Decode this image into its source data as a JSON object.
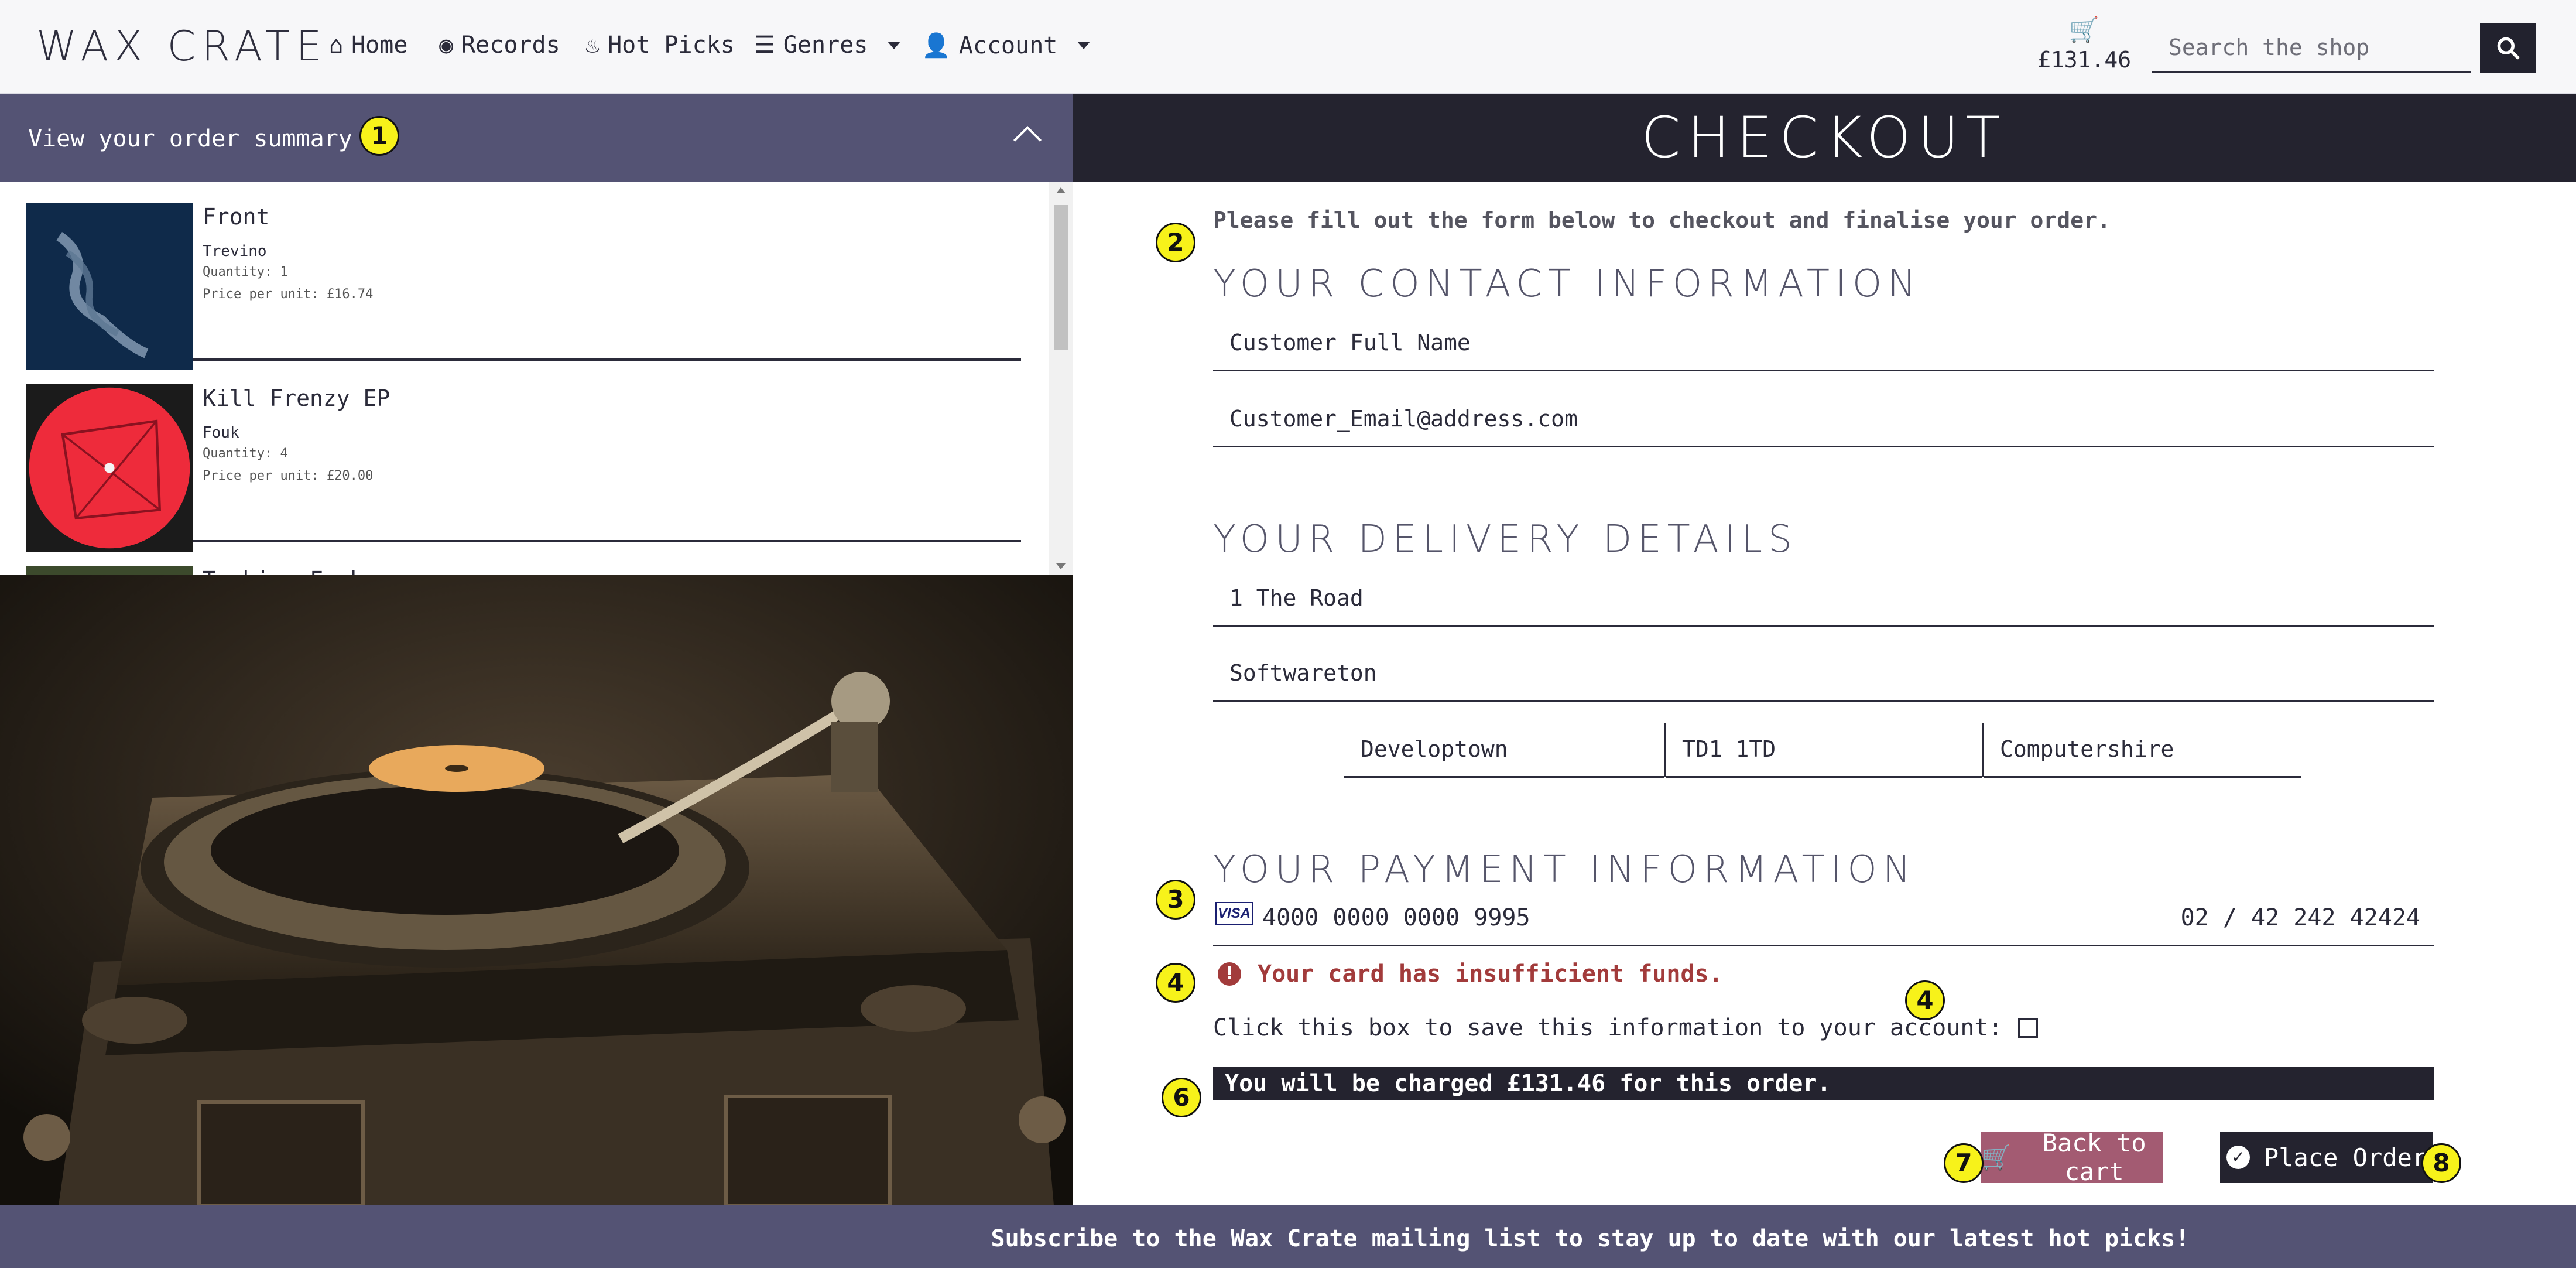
{
  "navbar": {
    "brand": "WAX CRATE",
    "items": [
      {
        "label": "Home",
        "icon": "home-icon"
      },
      {
        "label": "Records",
        "icon": "record-icon"
      },
      {
        "label": "Hot Picks",
        "icon": "flame-icon"
      },
      {
        "label": "Genres",
        "icon": "list-icon"
      },
      {
        "label": "Account",
        "icon": "user-gear-icon"
      }
    ],
    "cart_total": "£131.46",
    "search_placeholder": "Search the shop"
  },
  "order_summary": {
    "header": "View your order summary",
    "items": [
      {
        "title": "Front",
        "artist": "Trevino",
        "quantity": "Quantity: 1",
        "price": "Price per unit: £16.74"
      },
      {
        "title": "Kill Frenzy EP",
        "artist": "Fouk",
        "quantity": "Quantity: 4",
        "price": "Price per unit: £20.00"
      },
      {
        "title": "Techies Funk",
        "artist": "",
        "quantity": "",
        "price": ""
      }
    ]
  },
  "checkout": {
    "title": "CHECKOUT",
    "intro": "Please fill out the form below to checkout and finalise your order.",
    "contact": {
      "heading": "YOUR CONTACT INFORMATION",
      "full_name": "Customer Full Name",
      "email": "Customer_Email@address.com"
    },
    "delivery": {
      "heading": "YOUR DELIVERY DETAILS",
      "line1": "1 The Road",
      "line2": "Softwareton",
      "town": "Developtown",
      "postcode": "TD1 1TD",
      "county": "Computershire"
    },
    "payment": {
      "heading": "YOUR PAYMENT INFORMATION",
      "card_brand": "VISA",
      "card_number": "4000 0000 0000 9995",
      "expiry_cvc_zip": "02 / 42 242  42424"
    },
    "error": "Your card has insufficient funds.",
    "save_info_label": "Click this box to save this information to your account:",
    "save_info_checked": false,
    "charge_text": "You will be charged £131.46 for this order.",
    "back_button": "Back to cart",
    "place_button": "Place Order"
  },
  "markers": [
    "1",
    "2",
    "3",
    "4",
    "4",
    "6",
    "7",
    "8"
  ],
  "footer": {
    "text": "Subscribe to the Wax Crate mailing list to stay up to date with our latest hot picks!"
  },
  "colors": {
    "nav_bg": "#f7f7f9",
    "summary_header_bg": "#545374",
    "checkout_header_bg": "#24232f",
    "back_button_bg": "#a35b72",
    "error_text": "#a23b3b",
    "marker_fill": "#f7f21a"
  }
}
